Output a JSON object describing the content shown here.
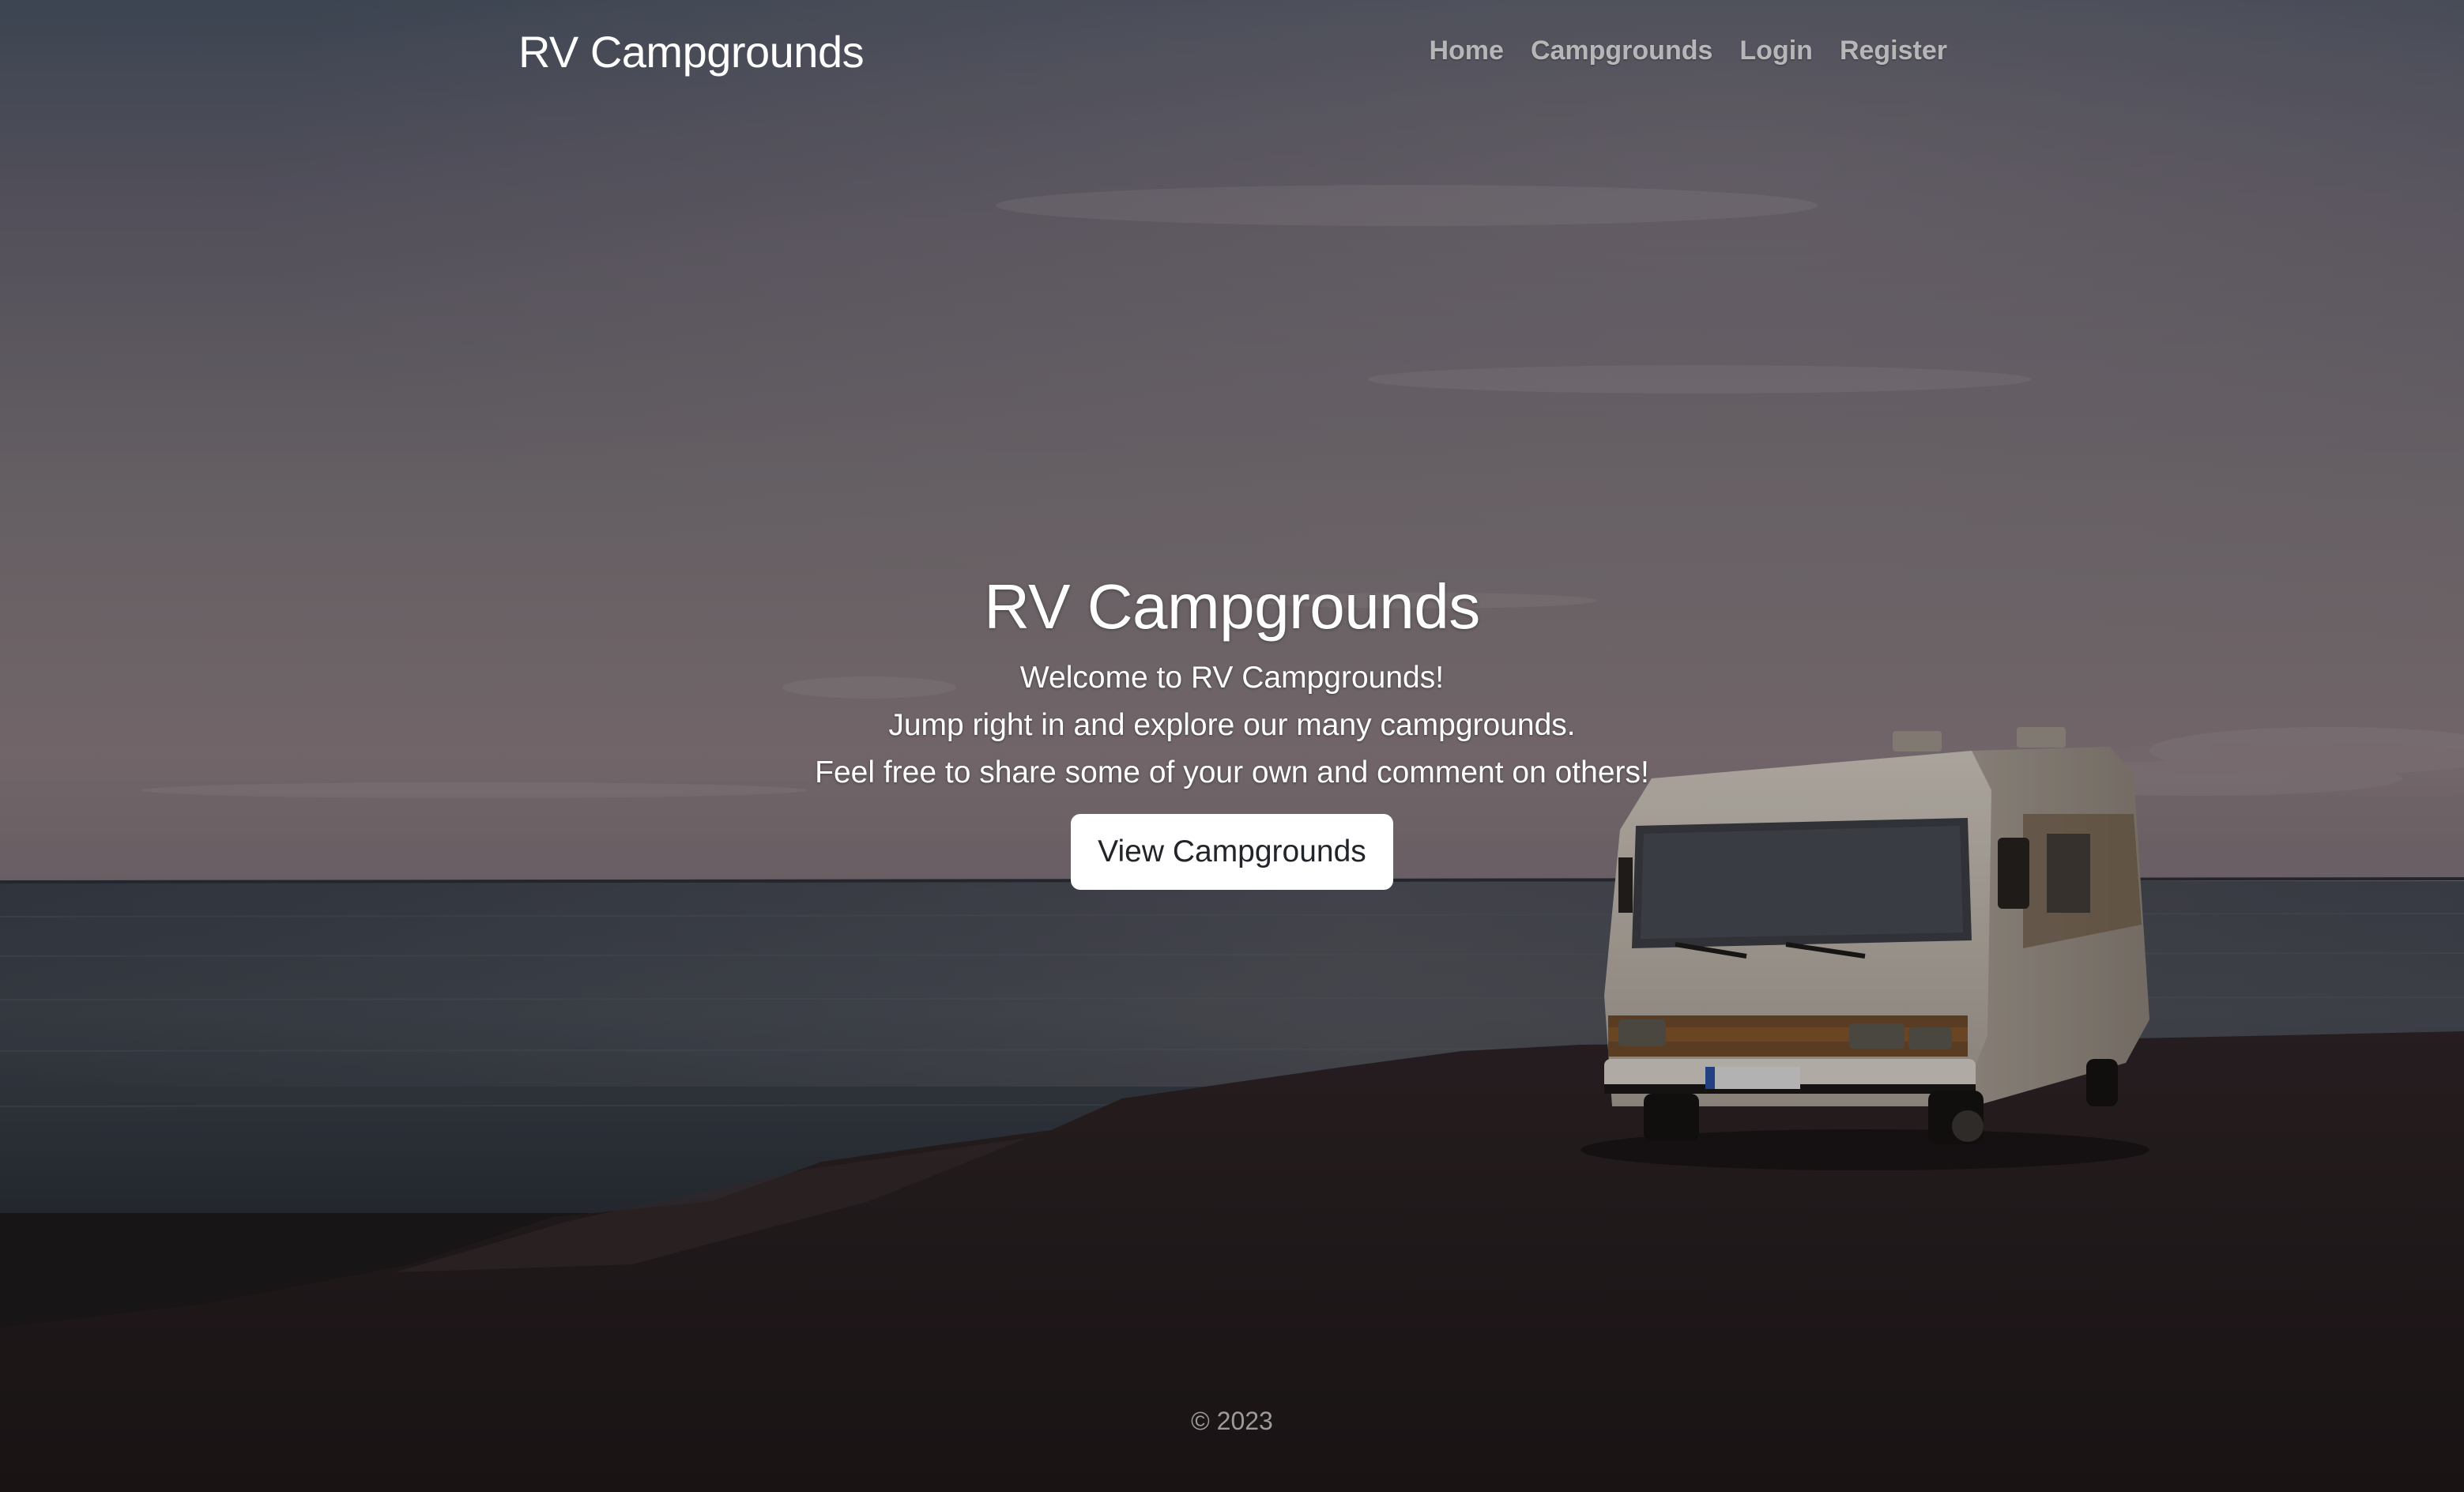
{
  "header": {
    "brand": "RV Campgrounds",
    "nav": {
      "home": "Home",
      "campgrounds": "Campgrounds",
      "login": "Login",
      "register": "Register"
    }
  },
  "hero": {
    "title": "RV Campgrounds",
    "lines": [
      "Welcome to RV Campgrounds!",
      "Jump right in and explore our many campgrounds.",
      "Feel free to share some of your own and comment on others!"
    ],
    "cta_label": "View Campgrounds"
  },
  "footer": {
    "copyright": "© 2023"
  },
  "colors": {
    "text_primary": "#ffffff",
    "nav_text": "#d2d2d2",
    "button_bg": "#ffffff",
    "button_text": "#212529"
  }
}
